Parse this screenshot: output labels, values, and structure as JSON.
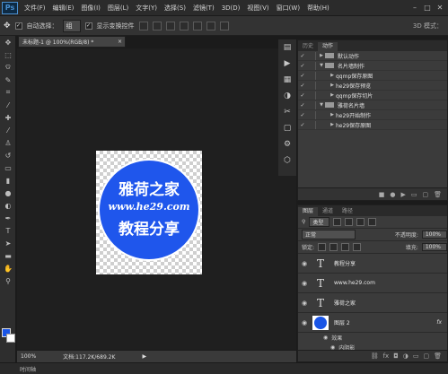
{
  "menubar": {
    "logo": "Ps",
    "items": [
      "文件(F)",
      "编辑(E)",
      "图像(I)",
      "图层(L)",
      "文字(Y)",
      "选择(S)",
      "滤镜(T)",
      "3D(D)",
      "视图(V)",
      "窗口(W)",
      "帮助(H)"
    ]
  },
  "options": {
    "auto_select_label": "自动选择：",
    "auto_select_value": "组",
    "show_transform_label": "显示变换控件",
    "mode_3d": "3D 模式："
  },
  "document": {
    "tab_title": "未标题-1 @ 100%(RGB/8) *",
    "image_text": {
      "line1": "雅荷之家",
      "line2": "www.he29.com",
      "line3": "教程分享"
    },
    "status_zoom": "100%",
    "status_doc": "文档:117.2K/689.2K"
  },
  "bottom": {
    "label": "时间轴"
  },
  "actions_panel": {
    "tabs": [
      "历史",
      "动作"
    ],
    "rows": [
      {
        "label": "默认动作",
        "level": 0,
        "folder": true
      },
      {
        "label": "名片墙制作",
        "level": 0,
        "folder": true
      },
      {
        "label": "qqmp保存原图",
        "level": 1,
        "folder": false
      },
      {
        "label": "he29保存预览",
        "level": 1,
        "folder": false
      },
      {
        "label": "qqmp保存切片",
        "level": 1,
        "folder": false
      },
      {
        "label": "雅荷名片墙",
        "level": 0,
        "folder": true
      },
      {
        "label": "he29开始制作",
        "level": 1,
        "folder": false
      },
      {
        "label": "he29保存原图",
        "level": 1,
        "folder": false
      }
    ]
  },
  "layers_panel": {
    "tabs": [
      "图层",
      "通道",
      "路径"
    ],
    "kind": "类型",
    "blend_mode": "正常",
    "opacity_label": "不透明度:",
    "opacity_value": "100%",
    "lock_label": "锁定:",
    "fill_label": "填充:",
    "fill_value": "100%",
    "layers": [
      {
        "name": "教程分享",
        "type": "text"
      },
      {
        "name": "www.he29.com",
        "type": "text"
      },
      {
        "name": "雅荷之家",
        "type": "text"
      },
      {
        "name": "图层 2",
        "type": "image",
        "fx": "fx"
      }
    ],
    "effects_label": "效果",
    "effect_item": "内阴影"
  }
}
